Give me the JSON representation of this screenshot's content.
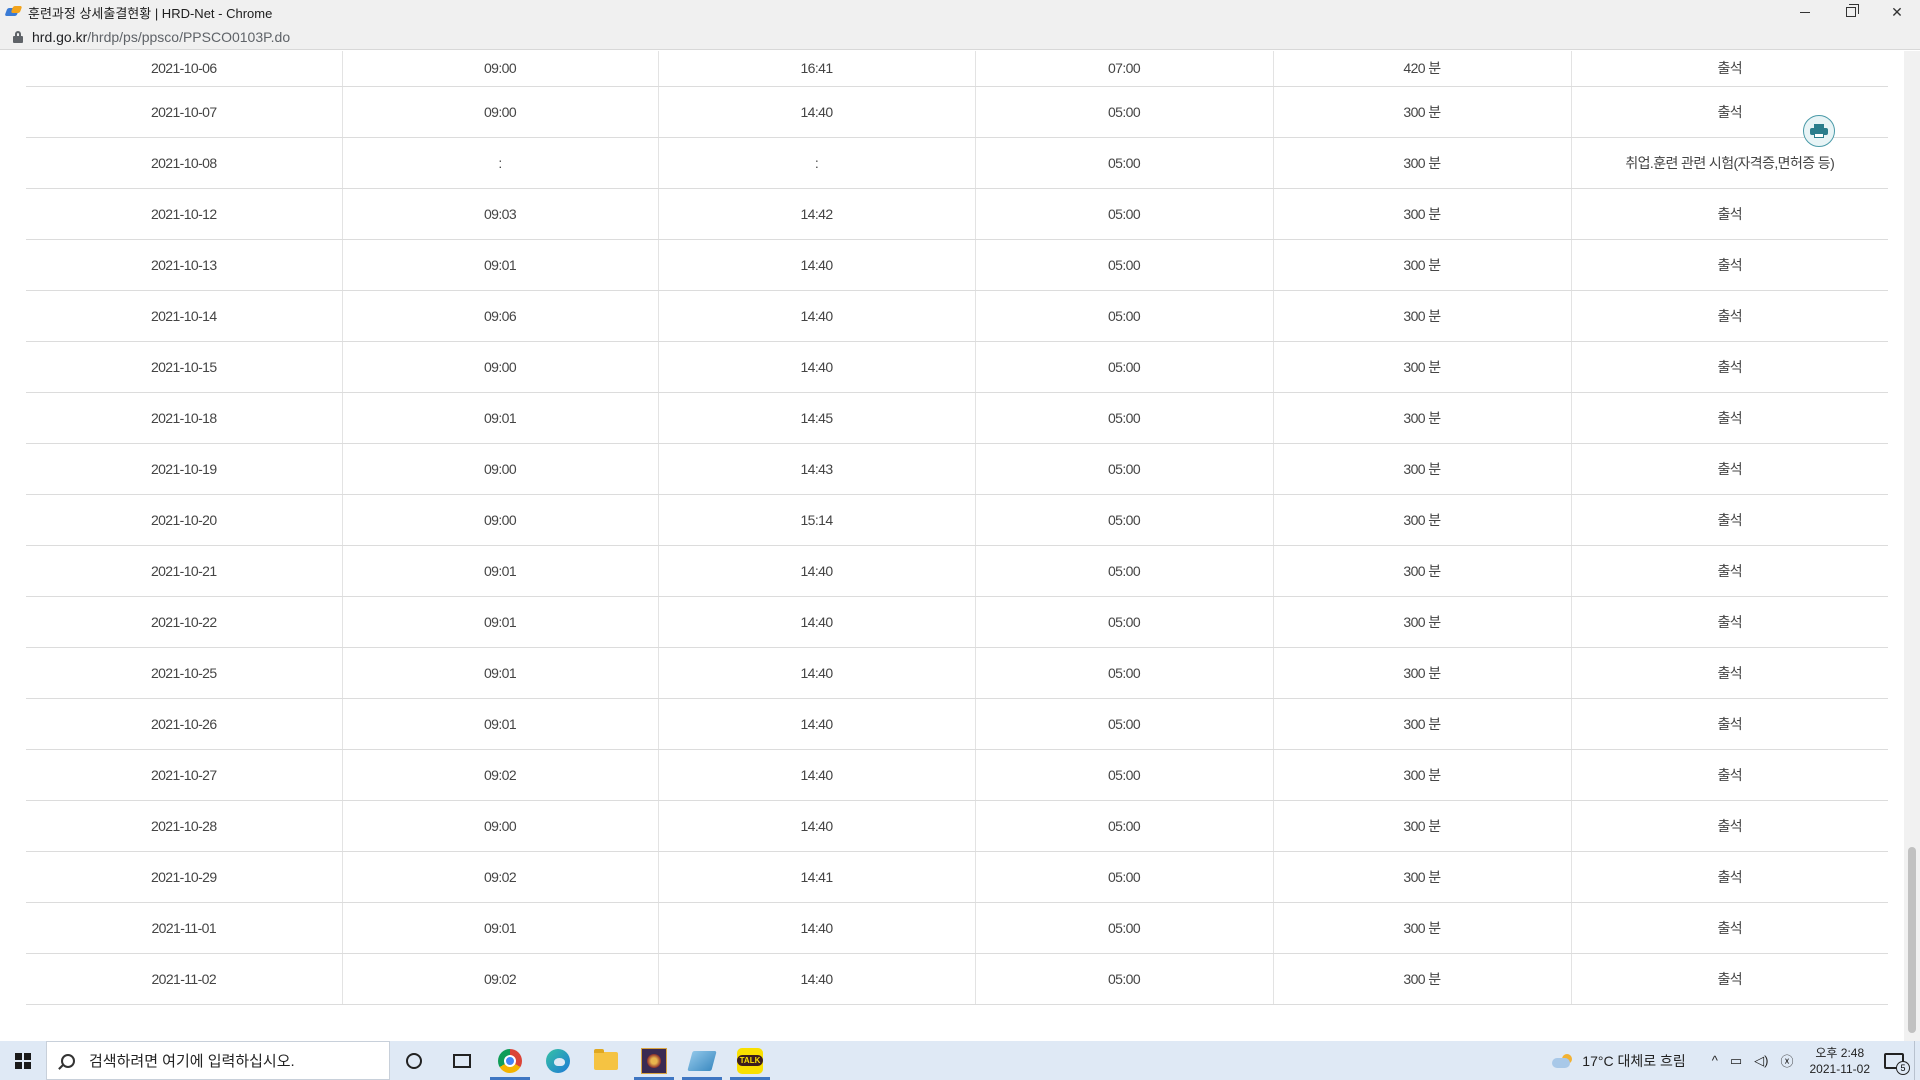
{
  "window": {
    "title": "훈련과정 상세출결현황 | HRD-Net - Chrome",
    "url_host": "hrd.go.kr",
    "url_path": "/hrdp/ps/ppsco/PPSCO0103P.do"
  },
  "icons": {
    "app": "hrd-net-icon",
    "lock": "lock-icon",
    "print": "printer-icon",
    "search": "search-icon"
  },
  "attendance": {
    "rows": [
      {
        "date": "2021-10-06",
        "in": "09:00",
        "out": "16:41",
        "hours": "07:00",
        "minutes": "420 분",
        "status": "출석"
      },
      {
        "date": "2021-10-07",
        "in": "09:00",
        "out": "14:40",
        "hours": "05:00",
        "minutes": "300 분",
        "status": "출석"
      },
      {
        "date": "2021-10-08",
        "in": ":",
        "out": ":",
        "hours": "05:00",
        "minutes": "300 분",
        "status": "취업.훈련 관련 시험(자격증,면허증 등)"
      },
      {
        "date": "2021-10-12",
        "in": "09:03",
        "out": "14:42",
        "hours": "05:00",
        "minutes": "300 분",
        "status": "출석"
      },
      {
        "date": "2021-10-13",
        "in": "09:01",
        "out": "14:40",
        "hours": "05:00",
        "minutes": "300 분",
        "status": "출석"
      },
      {
        "date": "2021-10-14",
        "in": "09:06",
        "out": "14:40",
        "hours": "05:00",
        "minutes": "300 분",
        "status": "출석"
      },
      {
        "date": "2021-10-15",
        "in": "09:00",
        "out": "14:40",
        "hours": "05:00",
        "minutes": "300 분",
        "status": "출석"
      },
      {
        "date": "2021-10-18",
        "in": "09:01",
        "out": "14:45",
        "hours": "05:00",
        "minutes": "300 분",
        "status": "출석"
      },
      {
        "date": "2021-10-19",
        "in": "09:00",
        "out": "14:43",
        "hours": "05:00",
        "minutes": "300 분",
        "status": "출석"
      },
      {
        "date": "2021-10-20",
        "in": "09:00",
        "out": "15:14",
        "hours": "05:00",
        "minutes": "300 분",
        "status": "출석"
      },
      {
        "date": "2021-10-21",
        "in": "09:01",
        "out": "14:40",
        "hours": "05:00",
        "minutes": "300 분",
        "status": "출석"
      },
      {
        "date": "2021-10-22",
        "in": "09:01",
        "out": "14:40",
        "hours": "05:00",
        "minutes": "300 분",
        "status": "출석"
      },
      {
        "date": "2021-10-25",
        "in": "09:01",
        "out": "14:40",
        "hours": "05:00",
        "minutes": "300 분",
        "status": "출석"
      },
      {
        "date": "2021-10-26",
        "in": "09:01",
        "out": "14:40",
        "hours": "05:00",
        "minutes": "300 분",
        "status": "출석"
      },
      {
        "date": "2021-10-27",
        "in": "09:02",
        "out": "14:40",
        "hours": "05:00",
        "minutes": "300 분",
        "status": "출석"
      },
      {
        "date": "2021-10-28",
        "in": "09:00",
        "out": "14:40",
        "hours": "05:00",
        "minutes": "300 분",
        "status": "출석"
      },
      {
        "date": "2021-10-29",
        "in": "09:02",
        "out": "14:41",
        "hours": "05:00",
        "minutes": "300 분",
        "status": "출석"
      },
      {
        "date": "2021-11-01",
        "in": "09:01",
        "out": "14:40",
        "hours": "05:00",
        "minutes": "300 분",
        "status": "출석"
      },
      {
        "date": "2021-11-02",
        "in": "09:02",
        "out": "14:40",
        "hours": "05:00",
        "minutes": "300 분",
        "status": "출석"
      }
    ]
  },
  "taskbar": {
    "search_placeholder": "검색하려면 여기에 입력하십시오.",
    "weather": "17°C  대체로 흐림",
    "time": "오후 2:48",
    "date": "2021-11-02",
    "notification_count": "5",
    "apps": [
      "chrome-icon",
      "edge-icon",
      "file-explorer-icon",
      "game-icon",
      "notepad-icon",
      "kakaotalk-icon"
    ]
  }
}
